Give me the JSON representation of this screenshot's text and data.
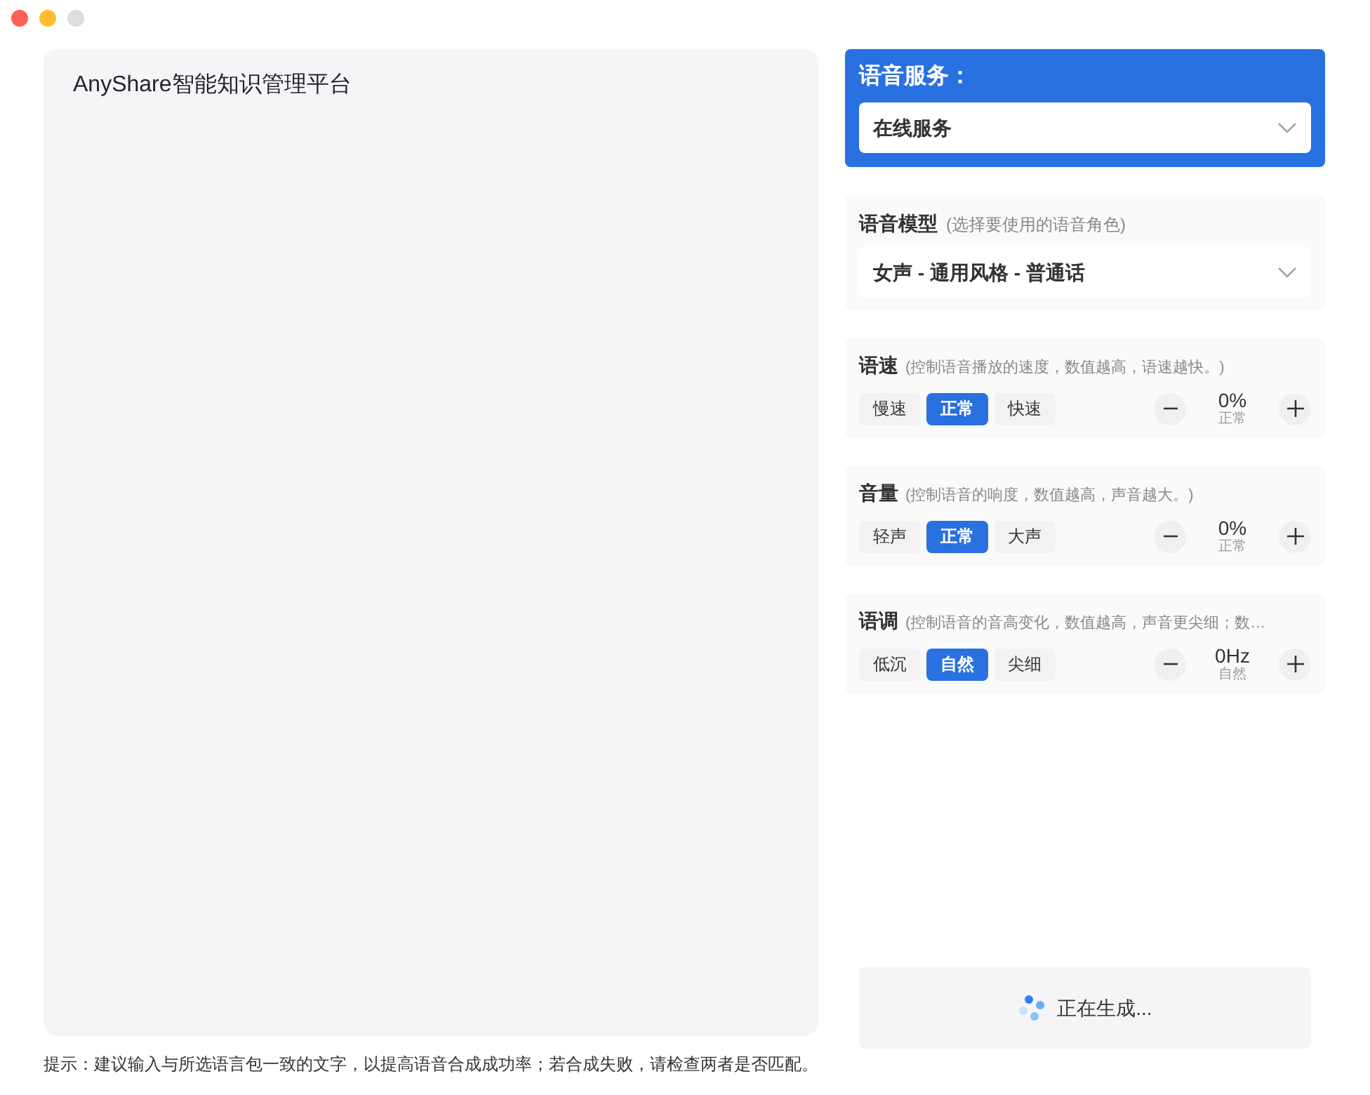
{
  "editor": {
    "value": "AnyShare智能知识管理平台"
  },
  "hint": "提示：建议输入与所选语言包一致的文字，以提高语音合成成功率；若合成失败，请检查两者是否匹配。",
  "service": {
    "title": "语音服务：",
    "value": "在线服务"
  },
  "model": {
    "title": "语音模型",
    "hint": "(选择要使用的语音角色)",
    "value": "女声 - 通用风格 - 普通话"
  },
  "adjusters": [
    {
      "title": "语速",
      "hint": "(控制语音播放的速度，数值越高，语速越快。)",
      "options": [
        {
          "label": "慢速",
          "selected": false
        },
        {
          "label": "正常",
          "selected": true
        },
        {
          "label": "快速",
          "selected": false
        }
      ],
      "value": "0%",
      "caption": "正常"
    },
    {
      "title": "音量",
      "hint": "(控制语音的响度，数值越高，声音越大。)",
      "options": [
        {
          "label": "轻声",
          "selected": false
        },
        {
          "label": "正常",
          "selected": true
        },
        {
          "label": "大声",
          "selected": false
        }
      ],
      "value": "0%",
      "caption": "正常"
    },
    {
      "title": "语调",
      "hint": "(控制语音的音高变化，数值越高，声音更尖细；数…",
      "options": [
        {
          "label": "低沉",
          "selected": false
        },
        {
          "label": "自然",
          "selected": true
        },
        {
          "label": "尖细",
          "selected": false
        }
      ],
      "value": "0Hz",
      "caption": "自然"
    }
  ],
  "generate": {
    "label": "正在生成...",
    "loading": true
  }
}
